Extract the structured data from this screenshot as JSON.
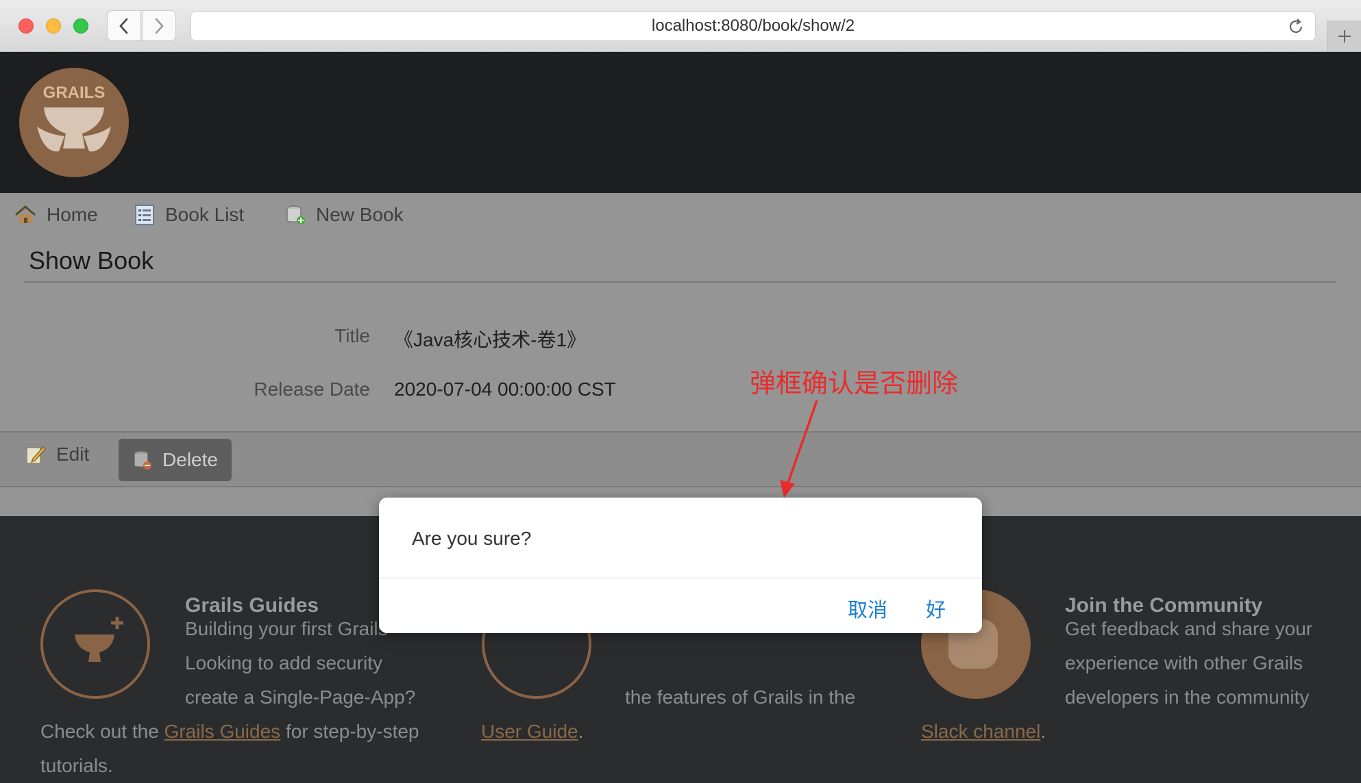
{
  "browser": {
    "url": "localhost:8080/book/show/2"
  },
  "header": {
    "logo_text": "GRAILS"
  },
  "nav": {
    "items": [
      {
        "label": "Home",
        "icon": "house-icon"
      },
      {
        "label": "Book List",
        "icon": "list-icon"
      },
      {
        "label": "New Book",
        "icon": "new-database-icon"
      }
    ]
  },
  "main": {
    "title": "Show Book",
    "properties": [
      {
        "label": "Title",
        "value": "《Java核心技术-卷1》"
      },
      {
        "label": "Release Date",
        "value": "2020-07-04 00:00:00 CST"
      }
    ],
    "edit_label": "Edit",
    "delete_label": "Delete"
  },
  "footer": {
    "col1": {
      "heading": "Grails Guides",
      "lines": [
        "Building your first Grails",
        "Looking to add security",
        "create a Single-Page-App?"
      ],
      "tail_prefix": "Check out the ",
      "link": "Grails Guides",
      "tail_suffix": " for step-by-step",
      "last": "tutorials."
    },
    "col2": {
      "line": "the features of Grails in the",
      "link": "User Guide",
      "suffix": "."
    },
    "col3": {
      "heading": "Join the Community",
      "lines": [
        "Get feedback and share your",
        "experience with other Grails",
        "developers in the community"
      ],
      "link": "Slack channel",
      "suffix": "."
    }
  },
  "dialog": {
    "message": "Are you sure?",
    "cancel_label": "取消",
    "ok_label": "好"
  },
  "annotation": {
    "text": "弹框确认是否删除",
    "color": "#ea2c2c"
  },
  "colors": {
    "grails_orange": "#c0895a",
    "dialog_button_blue": "#1a7ed6"
  }
}
